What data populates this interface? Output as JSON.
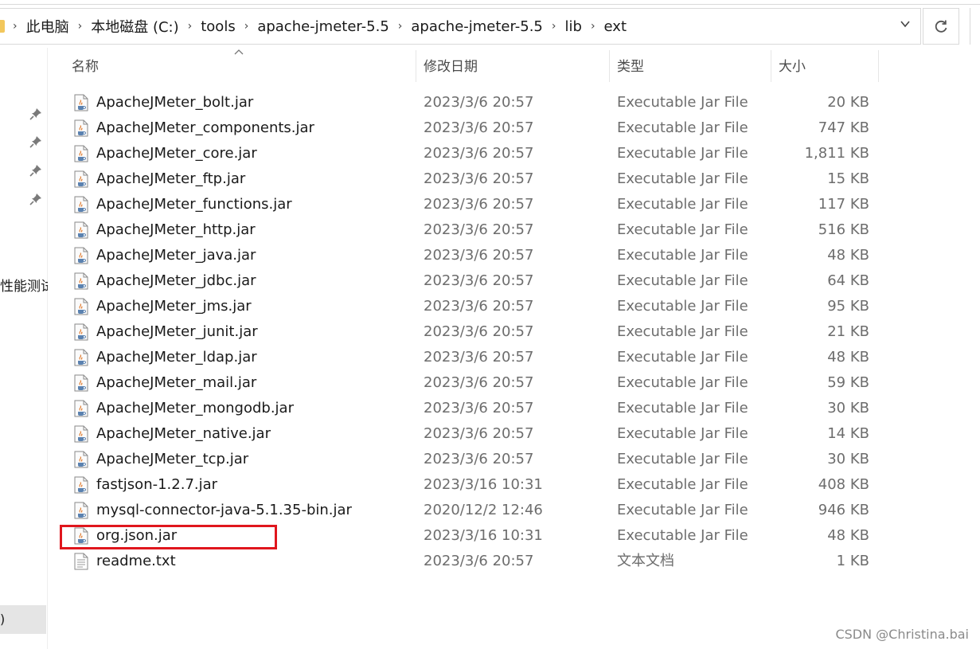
{
  "address_bar": {
    "crumbs": [
      "此电脑",
      "本地磁盘 (C:)",
      "tools",
      "apache-jmeter-5.5",
      "apache-jmeter-5.5",
      "lib",
      "ext"
    ]
  },
  "nav": {
    "partial_label": "性能测试",
    "selected_partial": ")"
  },
  "columns": {
    "name": "名称",
    "date": "修改日期",
    "type": "类型",
    "size": "大小"
  },
  "files": [
    {
      "name": "ApacheJMeter_bolt.jar",
      "date": "2023/3/6 20:57",
      "type": "Executable Jar File",
      "size": "20 KB",
      "icon": "jar-file-icon"
    },
    {
      "name": "ApacheJMeter_components.jar",
      "date": "2023/3/6 20:57",
      "type": "Executable Jar File",
      "size": "747 KB",
      "icon": "jar-file-icon"
    },
    {
      "name": "ApacheJMeter_core.jar",
      "date": "2023/3/6 20:57",
      "type": "Executable Jar File",
      "size": "1,811 KB",
      "icon": "jar-file-icon"
    },
    {
      "name": "ApacheJMeter_ftp.jar",
      "date": "2023/3/6 20:57",
      "type": "Executable Jar File",
      "size": "15 KB",
      "icon": "jar-file-icon"
    },
    {
      "name": "ApacheJMeter_functions.jar",
      "date": "2023/3/6 20:57",
      "type": "Executable Jar File",
      "size": "117 KB",
      "icon": "jar-file-icon"
    },
    {
      "name": "ApacheJMeter_http.jar",
      "date": "2023/3/6 20:57",
      "type": "Executable Jar File",
      "size": "516 KB",
      "icon": "jar-file-icon"
    },
    {
      "name": "ApacheJMeter_java.jar",
      "date": "2023/3/6 20:57",
      "type": "Executable Jar File",
      "size": "48 KB",
      "icon": "jar-file-icon"
    },
    {
      "name": "ApacheJMeter_jdbc.jar",
      "date": "2023/3/6 20:57",
      "type": "Executable Jar File",
      "size": "64 KB",
      "icon": "jar-file-icon"
    },
    {
      "name": "ApacheJMeter_jms.jar",
      "date": "2023/3/6 20:57",
      "type": "Executable Jar File",
      "size": "95 KB",
      "icon": "jar-file-icon"
    },
    {
      "name": "ApacheJMeter_junit.jar",
      "date": "2023/3/6 20:57",
      "type": "Executable Jar File",
      "size": "21 KB",
      "icon": "jar-file-icon"
    },
    {
      "name": "ApacheJMeter_ldap.jar",
      "date": "2023/3/6 20:57",
      "type": "Executable Jar File",
      "size": "48 KB",
      "icon": "jar-file-icon"
    },
    {
      "name": "ApacheJMeter_mail.jar",
      "date": "2023/3/6 20:57",
      "type": "Executable Jar File",
      "size": "59 KB",
      "icon": "jar-file-icon"
    },
    {
      "name": "ApacheJMeter_mongodb.jar",
      "date": "2023/3/6 20:57",
      "type": "Executable Jar File",
      "size": "30 KB",
      "icon": "jar-file-icon"
    },
    {
      "name": "ApacheJMeter_native.jar",
      "date": "2023/3/6 20:57",
      "type": "Executable Jar File",
      "size": "14 KB",
      "icon": "jar-file-icon"
    },
    {
      "name": "ApacheJMeter_tcp.jar",
      "date": "2023/3/6 20:57",
      "type": "Executable Jar File",
      "size": "30 KB",
      "icon": "jar-file-icon"
    },
    {
      "name": "fastjson-1.2.7.jar",
      "date": "2023/3/16 10:31",
      "type": "Executable Jar File",
      "size": "408 KB",
      "icon": "jar-file-icon"
    },
    {
      "name": "mysql-connector-java-5.1.35-bin.jar",
      "date": "2020/12/2 12:46",
      "type": "Executable Jar File",
      "size": "946 KB",
      "icon": "jar-file-icon"
    },
    {
      "name": "org.json.jar",
      "date": "2023/3/16 10:31",
      "type": "Executable Jar File",
      "size": "48 KB",
      "icon": "jar-file-icon"
    },
    {
      "name": "readme.txt",
      "date": "2023/3/6 20:57",
      "type": "文本文档",
      "size": "1 KB",
      "icon": "text-file-icon"
    }
  ],
  "highlight_color": "#e0161d",
  "watermark": "CSDN @Christina.bai"
}
